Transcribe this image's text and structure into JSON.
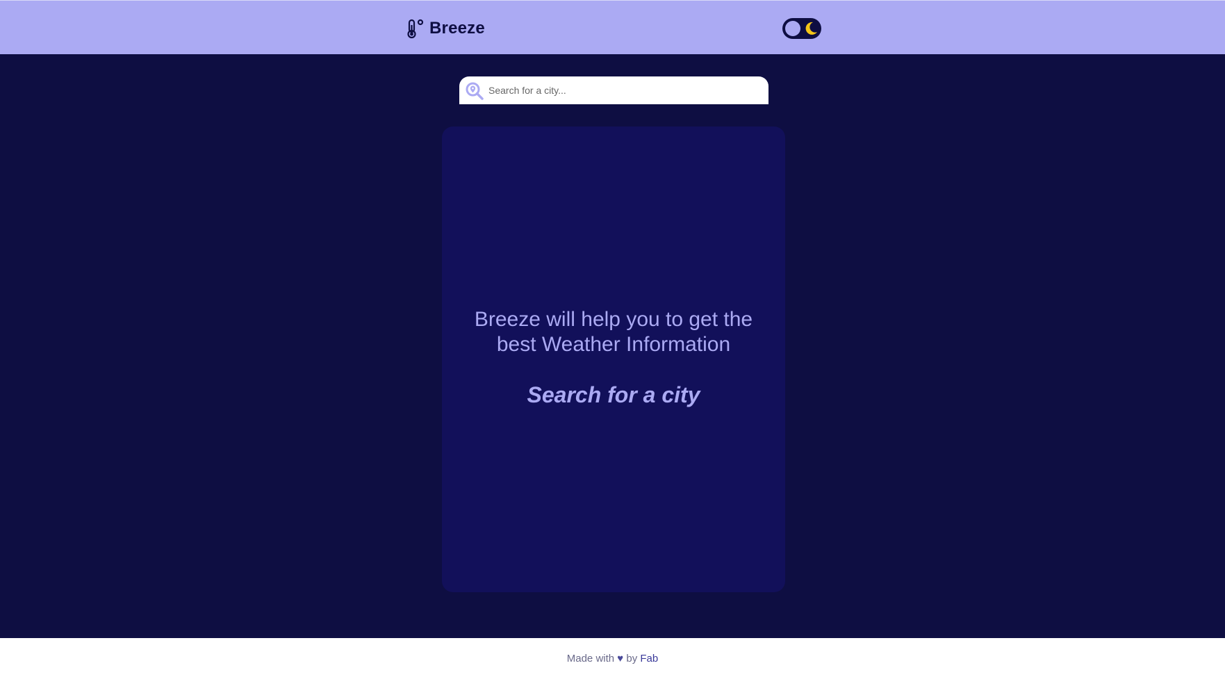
{
  "app": {
    "name": "Breeze"
  },
  "header": {
    "brand_icon": "thermometer-degree-icon",
    "brand_name": "Breeze",
    "theme_toggle": {
      "mode": "dark",
      "icon": "moon-icon"
    }
  },
  "search": {
    "icon": "search-location-icon",
    "placeholder": "Search for a city...",
    "value": ""
  },
  "card": {
    "tagline": "Breeze will help you to get the best Weather Information",
    "prompt": "Search for a city"
  },
  "footer": {
    "made_with": "Made with",
    "heart": "♥",
    "by": "by",
    "author": "Fab"
  },
  "colors": {
    "background": "#0e0e42",
    "header": "#abaaf3",
    "card": "#12105a",
    "accent_text": "#abaaf3",
    "moon": "#f5c518"
  }
}
